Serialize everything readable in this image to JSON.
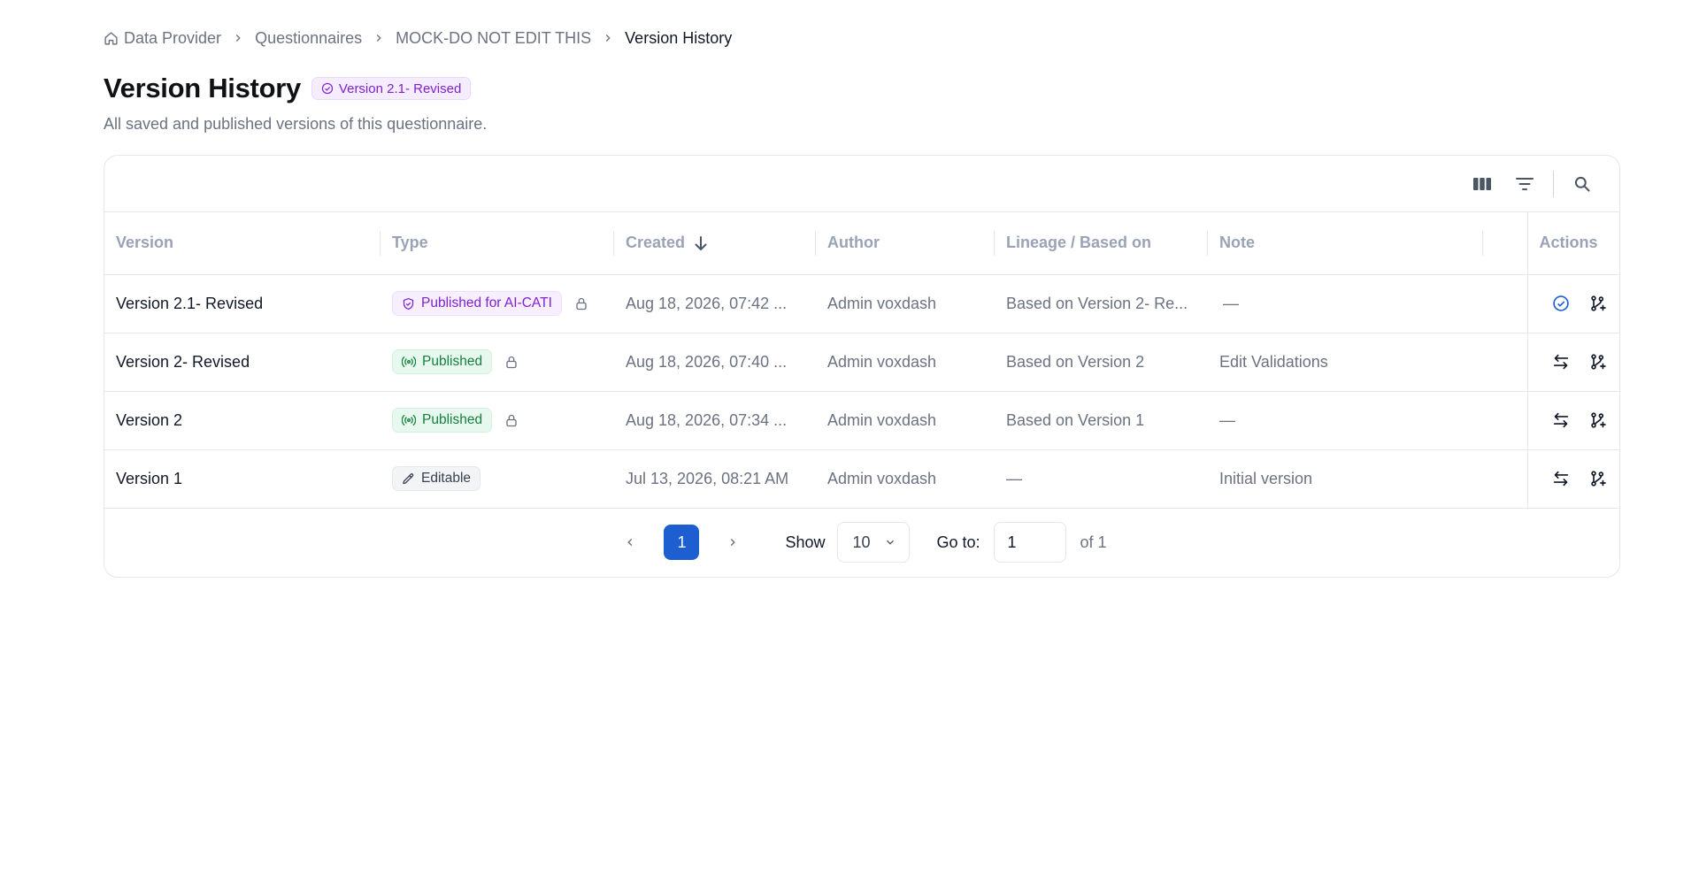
{
  "breadcrumb": [
    {
      "label": "Data Provider",
      "icon": "home-icon"
    },
    {
      "label": "Questionnaires"
    },
    {
      "label": "MOCK-DO NOT EDIT THIS"
    },
    {
      "label": "Version History"
    }
  ],
  "header": {
    "title": "Version History",
    "badge": "Version 2.1- Revised",
    "subtitle": "All saved and published versions of this questionnaire."
  },
  "toolbar": {
    "icons": [
      "columns-icon",
      "filter-icon",
      "search-icon"
    ]
  },
  "table": {
    "columns": {
      "version": "Version",
      "type": "Type",
      "created": "Created",
      "author": "Author",
      "lineage": "Lineage / Based on",
      "note": "Note",
      "actions": "Actions"
    },
    "sort": {
      "column": "created",
      "direction": "descending"
    },
    "rows": [
      {
        "version": "Version 2.1- Revised",
        "type": "Published for AI-CATI",
        "type_kind": "ai",
        "locked": true,
        "created": "Aug 18, 2026, 07:42 ...",
        "author": "Admin voxdash",
        "lineage": "Based on Version 2- Re...",
        "note": "—",
        "actions": [
          "current-version-icon",
          "branch-add-icon"
        ]
      },
      {
        "version": "Version 2- Revised",
        "type": "Published",
        "type_kind": "pub",
        "locked": true,
        "created": "Aug 18, 2026, 07:40 ...",
        "author": "Admin voxdash",
        "lineage": "Based on Version 2",
        "note": "Edit Validations",
        "actions": [
          "compare-icon",
          "branch-add-icon"
        ]
      },
      {
        "version": "Version 2",
        "type": "Published",
        "type_kind": "pub",
        "locked": true,
        "created": "Aug 18, 2026, 07:34 ...",
        "author": "Admin voxdash",
        "lineage": "Based on Version 1",
        "note": "—",
        "actions": [
          "compare-icon",
          "branch-add-icon"
        ]
      },
      {
        "version": "Version 1",
        "type": "Editable",
        "type_kind": "edit",
        "locked": false,
        "created": "Jul 13, 2026, 08:21 AM",
        "author": "Admin voxdash",
        "lineage": "—",
        "note": "Initial version",
        "actions": [
          "compare-icon",
          "branch-add-icon"
        ]
      }
    ]
  },
  "pagination": {
    "current_page": "1",
    "show_label": "Show",
    "page_size": "10",
    "goto_label": "Go to:",
    "goto_value": "1",
    "of_label": "of 1"
  },
  "colors": {
    "accent": "#1d5fd1",
    "ai_badge": "#7e22ce",
    "published_badge": "#15803d"
  }
}
